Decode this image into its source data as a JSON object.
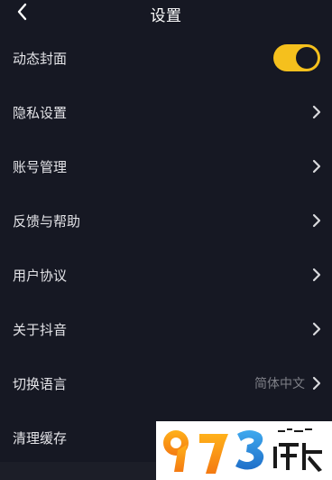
{
  "header": {
    "title": "设置",
    "back_icon": "chevron-left-icon"
  },
  "settings": {
    "dynamic_cover": {
      "label": "动态封面",
      "enabled": true,
      "toggle_color": "#f5c01d"
    },
    "privacy": {
      "label": "隐私设置"
    },
    "account": {
      "label": "账号管理"
    },
    "feedback": {
      "label": "反馈与帮助"
    },
    "user_agreement": {
      "label": "用户协议"
    },
    "about": {
      "label": "关于抖音"
    },
    "language": {
      "label": "切换语言",
      "value": "简体中文"
    },
    "clear_cache": {
      "label": "清理缓存"
    }
  },
  "colors": {
    "background": "#161823",
    "text": "#e4e4e8",
    "secondary_text": "#7e7f87"
  },
  "watermark": {
    "logo_text": "973游戏"
  }
}
